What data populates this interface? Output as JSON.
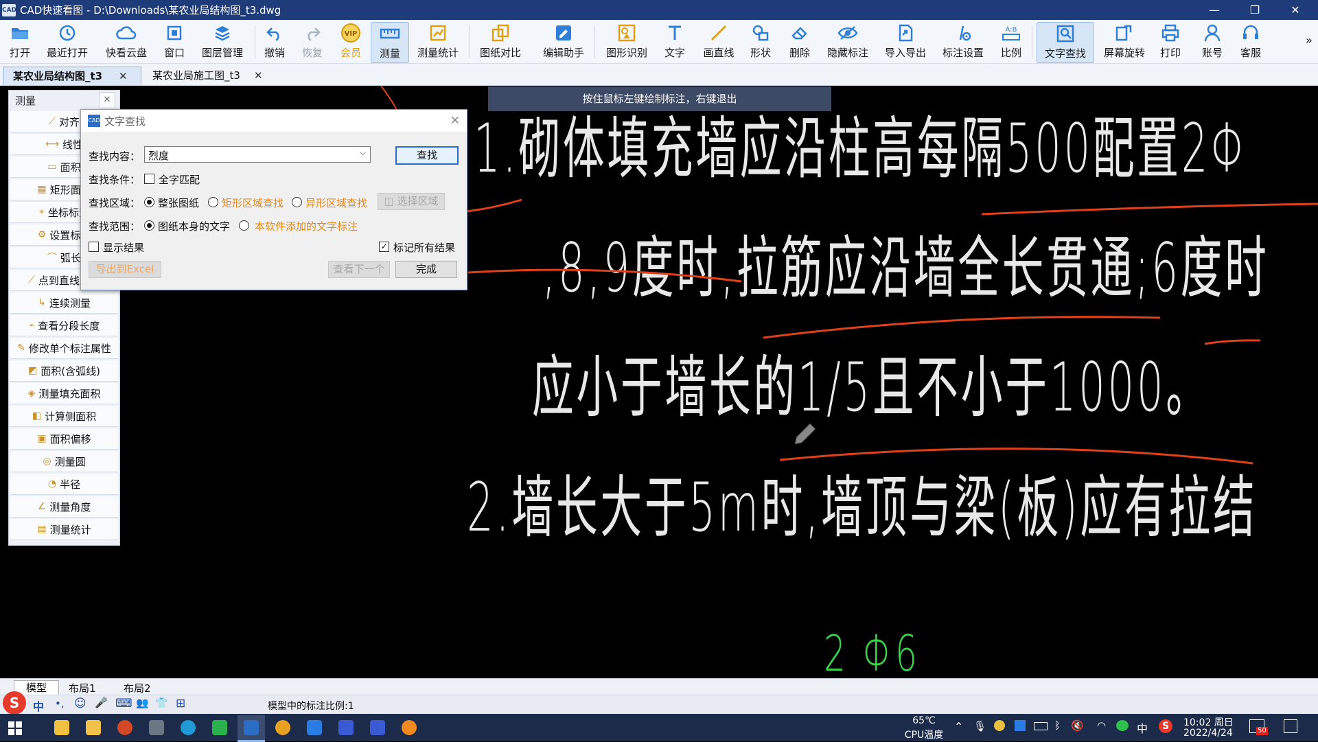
{
  "window": {
    "icon_text": "CAD",
    "title": "CAD快速看图 - D:\\Downloads\\某农业局结构图_t3.dwg",
    "controls": [
      "—",
      "❐",
      "✕"
    ]
  },
  "toolbar": [
    {
      "label": "打开",
      "icon": "folder-icon"
    },
    {
      "label": "最近打开",
      "icon": "history-icon"
    },
    {
      "label": "快看云盘",
      "icon": "cloud-icon"
    },
    {
      "label": "窗口",
      "icon": "window-icon"
    },
    {
      "label": "图层管理",
      "icon": "layers-icon"
    },
    {
      "label": "撤销",
      "icon": "undo-icon"
    },
    {
      "label": "恢复",
      "icon": "redo-icon"
    },
    {
      "label": "会员",
      "icon": "vip-icon",
      "icon_text": "VIP"
    },
    {
      "label": "测量",
      "icon": "ruler-icon"
    },
    {
      "label": "测量统计",
      "icon": "measure-stats-icon"
    },
    {
      "label": "图纸对比",
      "icon": "compare-icon"
    },
    {
      "label": "编辑助手",
      "icon": "edit-assistant-icon"
    },
    {
      "label": "图形识别",
      "icon": "shape-recognition-icon"
    },
    {
      "label": "文字",
      "icon": "text-icon"
    },
    {
      "label": "画直线",
      "icon": "line-icon"
    },
    {
      "label": "形状",
      "icon": "shape-icon"
    },
    {
      "label": "删除",
      "icon": "eraser-icon"
    },
    {
      "label": "隐藏标注",
      "icon": "hide-annotation-icon"
    },
    {
      "label": "导入导出",
      "icon": "import-export-icon"
    },
    {
      "label": "标注设置",
      "icon": "annotation-settings-icon"
    },
    {
      "label": "比例",
      "icon": "scale-icon",
      "icon_text": "A:B"
    },
    {
      "label": "文字查找",
      "icon": "text-search-icon"
    },
    {
      "label": "屏幕旋转",
      "icon": "rotate-screen-icon"
    },
    {
      "label": "打印",
      "icon": "printer-icon"
    },
    {
      "label": "账号",
      "icon": "account-icon"
    },
    {
      "label": "客服",
      "icon": "headset-icon"
    }
  ],
  "toolbar_more": "»",
  "doc_tabs": [
    {
      "label": "某农业局结构图_t3",
      "active": true
    },
    {
      "label": "某农业局施工图_t3",
      "active": false
    }
  ],
  "tab_close": "✕",
  "canvas": {
    "hint": "按住鼠标左键绘制标注，右键退出",
    "lines": [
      "1.砌体填充墙应沿柱高每隔500配置2Φ",
      ",8,9度时,拉筋应沿墙全长贯通;6度时",
      "应小于墙长的1/5且不小于1000。",
      "2.墙长大于5m时,墙顶与梁(板)应有拉结",
      "2 Φ6"
    ]
  },
  "measure_panel": {
    "title": "测量",
    "close": "✕",
    "items": [
      "对齐",
      "线性",
      "面积",
      "矩形面积",
      "坐标标注",
      "设置标注",
      "弧长",
      "点到直线距离",
      "连续测量",
      "查看分段长度",
      "修改单个标注属性",
      "面积(含弧线)",
      "测量填充面积",
      "计算侧面积",
      "面积偏移",
      "测量圆",
      "半径",
      "测量角度",
      "测量统计"
    ]
  },
  "find_dialog": {
    "title": "文字查找",
    "icon_text": "CAD",
    "close": "✕",
    "content_label": "查找内容：",
    "content_value": "烈度",
    "find_button": "查找",
    "condition_label": "查找条件：",
    "whole_match": "全字匹配",
    "area_label": "查找区域：",
    "area_options": [
      "整张图纸",
      "矩形区域查找",
      "异形区域查找"
    ],
    "select_area_button": "选择区域",
    "scope_label": "查找范围：",
    "scope_options": [
      "图纸本身的文字",
      "本软件添加的文字标注"
    ],
    "show_results": "显示结果",
    "mark_all": "标记所有结果",
    "export_button": "导出到Excel",
    "next_button": "查看下一个",
    "done_button": "完成"
  },
  "layout_tabs": [
    "模型",
    "布局1",
    "布局2"
  ],
  "status": {
    "scale_text": "模型中的标注比例:1",
    "ime": [
      "中",
      "•,",
      "☺",
      "🎤",
      "⌨",
      "👥",
      "👕",
      "⊞"
    ]
  },
  "taskbar": {
    "temp": "65℃",
    "temp_label": "CPU温度",
    "tray_lang": "中",
    "time": "10:02 周日",
    "date": "2022/4/24",
    "notif_badge": "50"
  },
  "colors": {
    "titlebar": "#1f3c7a",
    "accent": "#2b6cc4",
    "annotation_red": "#e0401a",
    "cad_text": "#e8e8e8",
    "cad_green": "#39d34a",
    "vip": "#e0a010",
    "disabled_orange": "#e08a1e"
  }
}
